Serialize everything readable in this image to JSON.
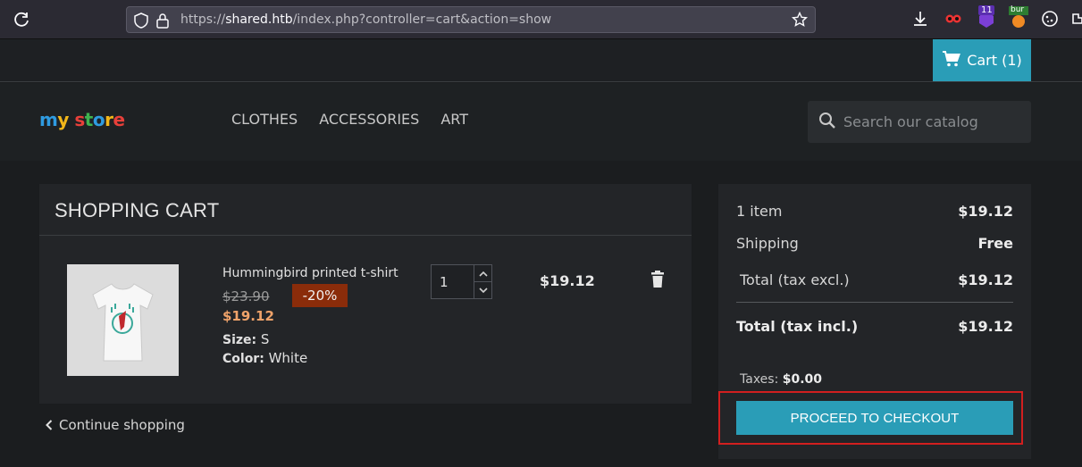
{
  "browser": {
    "url_prefix": "https://",
    "url_host": "shared.htb",
    "url_path": "/index.php?controller=cart&action=show",
    "ext_badge_count": "11",
    "ext_burp_label": "bur"
  },
  "topbar": {
    "cart_label": "Cart (1)"
  },
  "header": {
    "logo_text": "my store",
    "nav": [
      "CLOTHES",
      "ACCESSORIES",
      "ART"
    ],
    "search_placeholder": "Search our catalog"
  },
  "cart": {
    "title": "SHOPPING CART",
    "item": {
      "name": "Hummingbird printed t-shirt",
      "old_price": "$23.90",
      "discount": "-20%",
      "price": "$19.12",
      "size_label": "Size:",
      "size_value": "S",
      "color_label": "Color:",
      "color_value": "White",
      "quantity": "1",
      "line_total": "$19.12"
    },
    "continue_label": "Continue shopping"
  },
  "summary": {
    "items_label": "1 item",
    "items_value": "$19.12",
    "shipping_label": "Shipping",
    "shipping_value": "Free",
    "total_excl_label": "Total (tax excl.)",
    "total_excl_value": "$19.12",
    "total_incl_label": "Total (tax incl.)",
    "total_incl_value": "$19.12",
    "taxes_label": "Taxes:",
    "taxes_value": "$0.00",
    "checkout_label": "PROCEED TO CHECKOUT"
  },
  "colors": {
    "accent": "#2a9db7",
    "discount_bg": "#8a2c0a",
    "highlight_border": "#d21f1f",
    "sale_price": "#f0a36a"
  }
}
